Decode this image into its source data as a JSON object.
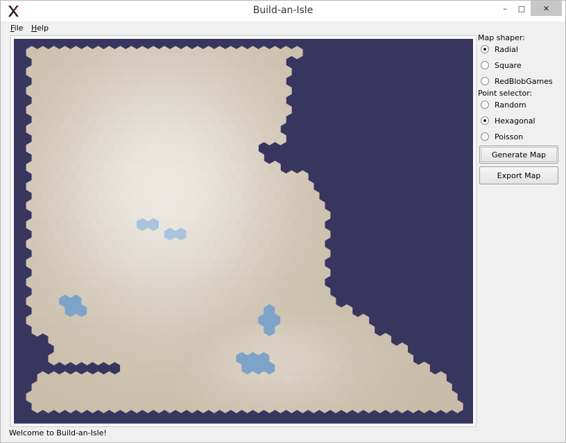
{
  "window": {
    "title": "Build-an-Isle",
    "minimize_glyph": "–",
    "maximize_glyph": "□",
    "close_glyph": "✕"
  },
  "menu": [
    {
      "label": "File",
      "mnemonic": "F",
      "rest": "ile"
    },
    {
      "label": "Help",
      "mnemonic": "H",
      "rest": "elp"
    }
  ],
  "sidebar": {
    "map_shaper_label": "Map shaper:",
    "map_shaper_options": [
      {
        "label": "Radial",
        "selected": true
      },
      {
        "label": "Square",
        "selected": false
      },
      {
        "label": "RedBlobGames",
        "selected": false
      }
    ],
    "point_selector_label": "Point selector:",
    "point_selector_options": [
      {
        "label": "Random",
        "selected": false
      },
      {
        "label": "Hexagonal",
        "selected": true
      },
      {
        "label": "Poisson",
        "selected": false
      }
    ],
    "generate_label": "Generate Map",
    "export_label": "Export Map"
  },
  "map": {
    "point_type": "hexagonal",
    "colors": {
      "ocean": "#38365e",
      "land_low": "#c3b49f",
      "land_high": "#ece8e1",
      "lake": "#7ea3c9",
      "lake_light": "#a9c4dc"
    }
  },
  "status": "Welcome to Build-an-Isle!"
}
